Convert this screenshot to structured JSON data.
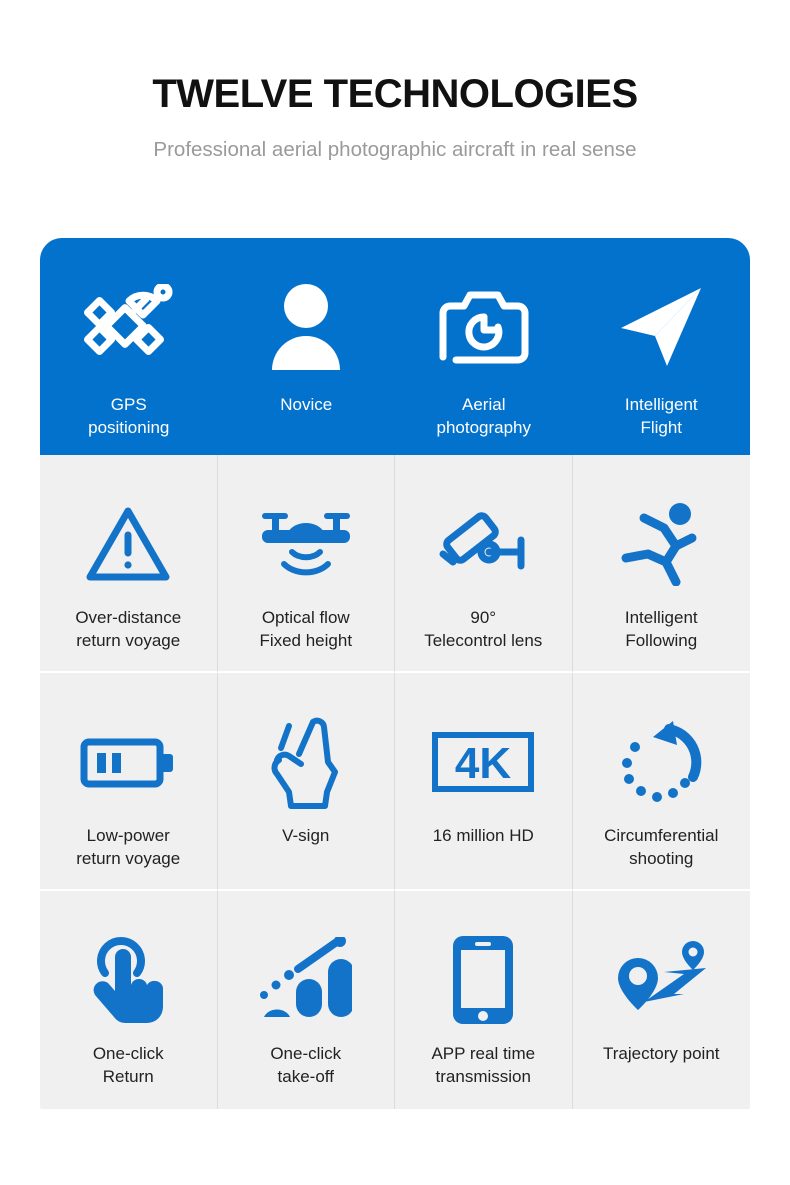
{
  "heading": {
    "title": "TWELVE TECHNOLOGIES",
    "subtitle": "Professional aerial photographic aircraft in real sense"
  },
  "colors": {
    "header_blue": "#0372CC",
    "icon_blue": "#1373C8",
    "cell_background": "#F0F0F0",
    "divider": "#dcdcdc",
    "title_text": "#111111",
    "subtitle_text": "#9a9a9a",
    "body_label_text": "#222222",
    "header_label_text": "#ffffff"
  },
  "features": {
    "header_row": [
      {
        "icon": "satellite-gps-icon",
        "label": "GPS\npositioning"
      },
      {
        "icon": "person-novice-icon",
        "label": "Novice"
      },
      {
        "icon": "camera-icon",
        "label": "Aerial\nphotography"
      },
      {
        "icon": "paper-plane-icon",
        "label": "Intelligent\nFlight"
      }
    ],
    "body_rows": [
      [
        {
          "icon": "warning-triangle-icon",
          "label": "Over-distance\nreturn voyage"
        },
        {
          "icon": "drone-optical-flow-icon",
          "label": "Optical flow\nFixed height"
        },
        {
          "icon": "cctv-lens-icon",
          "label": "90°\nTelecontrol lens"
        },
        {
          "icon": "running-person-icon",
          "label": "Intelligent\nFollowing"
        }
      ],
      [
        {
          "icon": "battery-low-icon",
          "label": "Low-power\nreturn voyage"
        },
        {
          "icon": "v-sign-hand-icon",
          "label": "V-sign"
        },
        {
          "icon": "four-k-badge-icon",
          "label": "16 million HD"
        },
        {
          "icon": "circular-dotted-arrow-icon",
          "label": "Circumferential\nshooting"
        }
      ],
      [
        {
          "icon": "tap-hand-icon",
          "label": "One-click\nReturn"
        },
        {
          "icon": "ascending-bars-arrow-icon",
          "label": "One-click\ntake-off"
        },
        {
          "icon": "smartphone-icon",
          "label": "APP real time\ntransmission"
        },
        {
          "icon": "trajectory-pin-path-icon",
          "label": "Trajectory point"
        }
      ]
    ]
  }
}
